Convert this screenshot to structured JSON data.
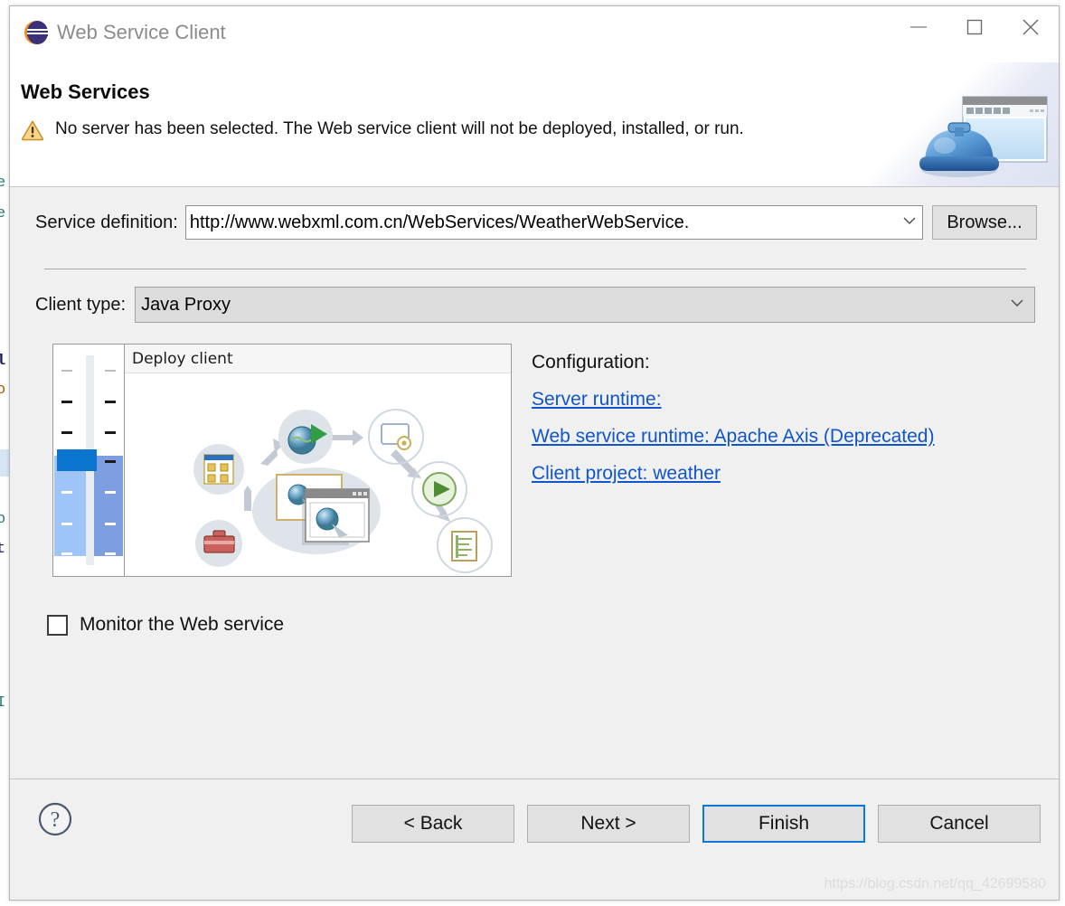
{
  "window": {
    "title": "Web Service Client",
    "app_icon": "eclipse-icon",
    "minimize_label": "Minimize",
    "maximize_label": "Maximize",
    "close_label": "Close"
  },
  "banner": {
    "title": "Web Services",
    "warning_icon": "warning-triangle-icon",
    "message": "No server has been selected. The Web service client will not be deployed, installed, or run.",
    "art_icon": "web-service-dome-window-icon"
  },
  "form": {
    "service_definition_label": "Service definition:",
    "service_definition_value": "http://www.webxml.com.cn/WebServices/WeatherWebService.",
    "browse_label": "Browse...",
    "client_type_label": "Client type:",
    "client_type_value": "Java Proxy"
  },
  "deploy_panel": {
    "title": "Deploy client",
    "scale_name": "service-generation-scale"
  },
  "configuration": {
    "heading": "Configuration:",
    "links": [
      "Server runtime: ",
      "Web service runtime: Apache Axis (Deprecated)",
      "Client project: weather"
    ]
  },
  "options": {
    "monitor_label": "Monitor the Web service",
    "monitor_checked": false
  },
  "footer": {
    "help_icon": "help-question-icon",
    "buttons": [
      {
        "label": "< Back",
        "name": "back-button",
        "default": false
      },
      {
        "label": "Next >",
        "name": "next-button",
        "default": false
      },
      {
        "label": "Finish",
        "name": "finish-button",
        "default": true
      },
      {
        "label": "Cancel",
        "name": "cancel-button",
        "default": false
      }
    ]
  },
  "watermark": "https://blog.csdn.net/qq_42699580",
  "colors": {
    "accent": "#0a78d4",
    "link": "#1155cc",
    "dialog_bg": "#f0f0f0",
    "warning": "#e8b54d"
  }
}
